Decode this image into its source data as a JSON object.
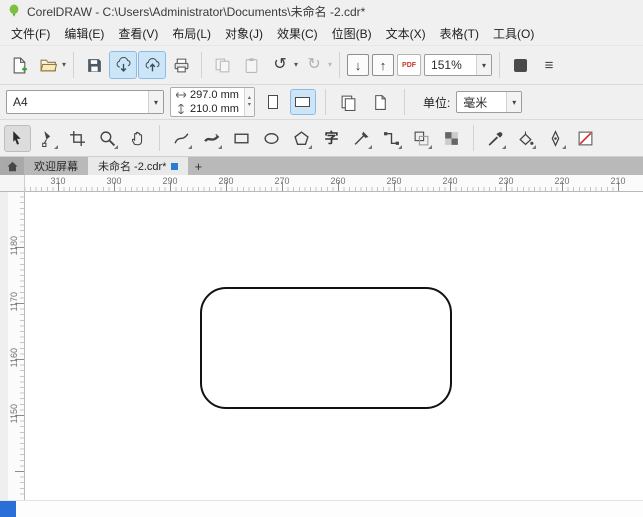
{
  "colors": {
    "accent": "#2b7cd3",
    "selection_bg": "#cde6f7",
    "selection_border": "#89bde8",
    "shape_stroke": "#121212",
    "bottom_swatch": "#2a6fd8"
  },
  "title_bar": {
    "title": "CorelDRAW - C:\\Users\\Administrator\\Documents\\未命名 -2.cdr*"
  },
  "menu": {
    "items": [
      "文件(F)",
      "编辑(E)",
      "查看(V)",
      "布局(L)",
      "对象(J)",
      "效果(C)",
      "位图(B)",
      "文本(X)",
      "表格(T)",
      "工具(O)"
    ]
  },
  "icons": {
    "caret": "▾",
    "undo": "↺",
    "redo": "↻",
    "import": "↓",
    "export": "↑",
    "spin_up": "▴",
    "spin_down": "▾",
    "menu_lines": "≡"
  },
  "toolbar": {
    "zoom_value": "151%",
    "pdf_label": "PDF"
  },
  "property_bar": {
    "page_size": "A4",
    "page_width": "297.0 mm",
    "page_height": "210.0 mm",
    "units_label": "单位:",
    "units_value": "毫米"
  },
  "toolbox": {
    "text_tool_glyph": "字"
  },
  "tab_bar": {
    "tabs": [
      "欢迎屏幕",
      "未命名 -2.cdr*"
    ],
    "new_tab": "+"
  },
  "rulers": {
    "horizontal": [
      "310",
      "300",
      "290",
      "280",
      "270",
      "260",
      "250",
      "240",
      "230",
      "220",
      "210"
    ],
    "vertical": [
      "1180",
      "1170",
      "1160",
      "1150"
    ]
  },
  "canvas": {
    "objects": [
      {
        "type": "rounded-rectangle",
        "stroke": "#121212",
        "corner_radius_px": 26
      }
    ]
  }
}
